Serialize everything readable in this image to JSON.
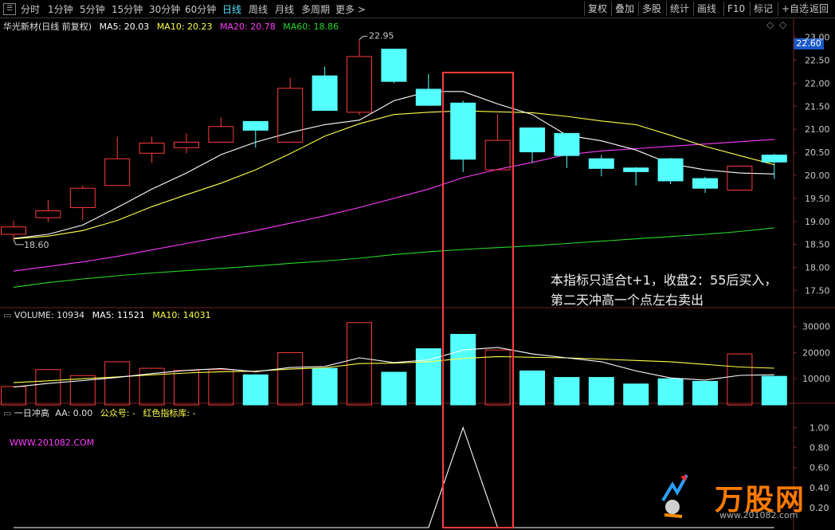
{
  "toolbar": {
    "periods": [
      "分时",
      "1分钟",
      "5分钟",
      "15分钟",
      "30分钟",
      "60分钟",
      "日线",
      "周线",
      "月线",
      "多周期",
      "更多 >"
    ],
    "active_period": "日线",
    "right_buttons": [
      "复权",
      "叠加",
      "多股",
      "统计",
      "画线",
      "F10",
      "标记",
      "+自选",
      "返回"
    ]
  },
  "price_panel": {
    "stock_title": "华光新材(日线 前复权)",
    "ma5": "MA5: 20.03",
    "ma10": "MA10: 20.23",
    "ma20": "MA20: 20.78",
    "ma60": "MA60: 18.86",
    "high_label": "22.95",
    "low_label": "18.60",
    "current_price_tag": "22.60",
    "y_ticks": [
      "23.00",
      "22.50",
      "22.00",
      "21.50",
      "21.00",
      "20.50",
      "20.00",
      "19.50",
      "19.00",
      "18.50",
      "18.00",
      "17.50"
    ]
  },
  "volume_panel": {
    "volume": "VOLUME: 10934",
    "ma5": "MA5: 11521",
    "ma10": "MA10: 14031",
    "y_ticks": [
      "30000",
      "20000",
      "10000"
    ]
  },
  "indicator_panel": {
    "name": "一日冲高",
    "aa": "AA: 0.00",
    "gzh": "公众号: -",
    "lib": "红色指标库: -",
    "site": "WWW.201082.COM",
    "y_ticks": [
      "1.00",
      "0.80",
      "0.60",
      "0.40",
      "0.20"
    ]
  },
  "annotation": {
    "line1": "本指标只适合t+1，收盘2：55后买入，",
    "line2": "第二天冲高一个点左右卖出"
  },
  "watermark": {
    "brand": "万股网",
    "url": "www.201082.com"
  },
  "colors": {
    "up": "#ff3b3b",
    "down": "#54ffff",
    "ma5": "#ffffff",
    "ma10": "#ffff4a",
    "ma20": "#ff3cff",
    "ma60": "#27d927",
    "highlight_box": "#ff3b3b",
    "active_tab": "#55e0ff"
  },
  "chart_data": {
    "type": "candlestick",
    "price_candles": [
      {
        "o": 18.72,
        "c": 18.88,
        "h": 19.02,
        "l": 18.6,
        "dir": "up"
      },
      {
        "o": 19.08,
        "c": 19.23,
        "h": 19.47,
        "l": 18.98,
        "dir": "up"
      },
      {
        "o": 19.3,
        "c": 19.72,
        "h": 19.78,
        "l": 19.02,
        "dir": "up"
      },
      {
        "o": 19.78,
        "c": 20.36,
        "h": 20.84,
        "l": 19.78,
        "dir": "up"
      },
      {
        "o": 20.48,
        "c": 20.7,
        "h": 20.84,
        "l": 20.27,
        "dir": "up"
      },
      {
        "o": 20.6,
        "c": 20.72,
        "h": 20.91,
        "l": 20.48,
        "dir": "up"
      },
      {
        "o": 20.72,
        "c": 21.06,
        "h": 21.26,
        "l": 20.72,
        "dir": "up"
      },
      {
        "o": 21.17,
        "c": 20.98,
        "h": 21.17,
        "l": 20.6,
        "dir": "down"
      },
      {
        "o": 20.72,
        "c": 21.89,
        "h": 22.12,
        "l": 20.72,
        "dir": "up"
      },
      {
        "o": 22.16,
        "c": 21.41,
        "h": 22.36,
        "l": 21.41,
        "dir": "down"
      },
      {
        "o": 21.37,
        "c": 22.58,
        "h": 22.95,
        "l": 21.31,
        "dir": "up"
      },
      {
        "o": 22.74,
        "c": 22.04,
        "h": 22.74,
        "l": 22.0,
        "dir": "down"
      },
      {
        "o": 21.87,
        "c": 21.52,
        "h": 22.2,
        "l": 21.52,
        "dir": "down"
      },
      {
        "o": 21.57,
        "c": 20.35,
        "h": 21.62,
        "l": 20.07,
        "dir": "down"
      },
      {
        "o": 20.12,
        "c": 20.76,
        "h": 21.33,
        "l": 20.12,
        "dir": "up"
      },
      {
        "o": 21.03,
        "c": 20.51,
        "h": 21.03,
        "l": 20.28,
        "dir": "down"
      },
      {
        "o": 20.91,
        "c": 20.43,
        "h": 20.91,
        "l": 20.16,
        "dir": "down"
      },
      {
        "o": 20.36,
        "c": 20.15,
        "h": 20.44,
        "l": 19.98,
        "dir": "down"
      },
      {
        "o": 20.16,
        "c": 20.08,
        "h": 20.18,
        "l": 19.78,
        "dir": "down"
      },
      {
        "o": 20.36,
        "c": 19.88,
        "h": 20.38,
        "l": 19.81,
        "dir": "down"
      },
      {
        "o": 19.93,
        "c": 19.72,
        "h": 19.97,
        "l": 19.62,
        "dir": "down"
      },
      {
        "o": 19.68,
        "c": 20.2,
        "h": 20.2,
        "l": 19.68,
        "dir": "up"
      },
      {
        "o": 20.44,
        "c": 20.29,
        "h": 20.47,
        "l": 19.92,
        "dir": "down"
      }
    ],
    "ma5_line": [
      18.63,
      18.72,
      18.92,
      19.3,
      19.7,
      20.05,
      20.45,
      20.72,
      20.93,
      21.1,
      21.2,
      21.62,
      21.82,
      21.82,
      21.55,
      21.32,
      20.87,
      20.75,
      20.55,
      20.25,
      20.12,
      20.05,
      20.03
    ],
    "ma10_line": [
      18.62,
      18.68,
      18.8,
      19.02,
      19.32,
      19.58,
      19.83,
      20.12,
      20.47,
      20.85,
      21.12,
      21.32,
      21.37,
      21.4,
      21.38,
      21.36,
      21.28,
      21.18,
      21.1,
      20.87,
      20.63,
      20.43,
      20.23
    ],
    "ma20_line": [
      17.92,
      18.02,
      18.12,
      18.24,
      18.38,
      18.52,
      18.66,
      18.8,
      18.96,
      19.12,
      19.3,
      19.5,
      19.7,
      19.95,
      20.13,
      20.28,
      20.45,
      20.53,
      20.58,
      20.63,
      20.68,
      20.73,
      20.78
    ],
    "ma60_line": [
      17.57,
      17.67,
      17.75,
      17.82,
      17.88,
      17.93,
      17.98,
      18.03,
      18.09,
      18.14,
      18.2,
      18.28,
      18.34,
      18.39,
      18.43,
      18.47,
      18.52,
      18.57,
      18.62,
      18.67,
      18.72,
      18.78,
      18.86
    ],
    "volume_bars": [
      7000,
      13500,
      11200,
      16500,
      14000,
      13200,
      13500,
      11500,
      20000,
      14000,
      31500,
      12500,
      21500,
      27000,
      21000,
      13000,
      10500,
      10500,
      8000,
      10000,
      9000,
      19500,
      10934
    ],
    "volume_ma5": [
      6800,
      8200,
      9300,
      10500,
      12000,
      13200,
      13900,
      12700,
      14300,
      14700,
      18000,
      16200,
      17200,
      21000,
      22000,
      19500,
      18000,
      16500,
      13000,
      10300,
      9500,
      11300,
      11521
    ],
    "volume_ma10": [
      8500,
      9200,
      10000,
      10700,
      11500,
      12200,
      12700,
      12900,
      13700,
      14200,
      15800,
      16000,
      16500,
      17800,
      18500,
      18200,
      18000,
      17500,
      17000,
      16500,
      15500,
      14500,
      14031
    ],
    "indicator_line": [
      0,
      0,
      0,
      0,
      0,
      0,
      0,
      0,
      0,
      0,
      0,
      0,
      0,
      1.0,
      0,
      0,
      0,
      0,
      0,
      0,
      0,
      0,
      0
    ],
    "price_ylim": [
      17.3,
      23.15
    ],
    "volume_ylim": [
      0,
      36000
    ],
    "indicator_ylim": [
      0,
      1.1
    ]
  }
}
